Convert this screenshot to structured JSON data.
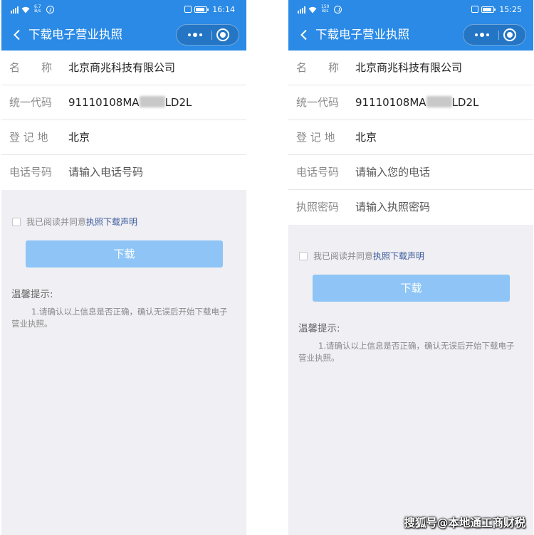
{
  "left": {
    "status_bar": {
      "speed_top": "6.7",
      "speed_unit": "B/s",
      "time": "16:14"
    },
    "nav": {
      "title": "下载电子营业执照"
    },
    "form": {
      "name_label": "名　　称",
      "name_value": "北京商兆科技有限公司",
      "code_label": "统一代码",
      "code_prefix": "91110108MA",
      "code_suffix": "LD2L",
      "region_label": "登 记 地",
      "region_value": "北京",
      "phone_label": "电话号码",
      "phone_placeholder": "请输入电话号码"
    },
    "agree": {
      "text": "我已阅读并同意",
      "link": "执照下载声明"
    },
    "download_label": "下载",
    "tips": {
      "title": "温馨提示:",
      "body": "1.请确认以上信息是否正确，确认无误后开始下载电子营业执照。"
    }
  },
  "right": {
    "status_bar": {
      "speed_top": "150",
      "speed_unit": "B/s",
      "time": "15:25"
    },
    "nav": {
      "title": "下载电子营业执照"
    },
    "form": {
      "name_label": "名　　称",
      "name_value": "北京商兆科技有限公司",
      "code_label": "统一代码",
      "code_prefix": "91110108MA",
      "code_suffix": "LD2L",
      "region_label": "登 记 地",
      "region_value": "北京",
      "phone_label": "电话号码",
      "phone_placeholder": "请输入您的电话",
      "password_label": "执照密码",
      "password_placeholder": "请输入执照密码"
    },
    "agree": {
      "text": "我已阅读并同意",
      "link": "执照下载声明"
    },
    "download_label": "下载",
    "tips": {
      "title": "温馨提示:",
      "body": "1.请确认以上信息是否正确，确认无误后开始下载电子营业执照。"
    }
  },
  "watermark": "搜狐号@本地通工商财税",
  "colors": {
    "nav_blue": "#2a8ae6",
    "button_disabled": "#8ec5f6",
    "link": "#3b5998",
    "page_bg": "#efeff4"
  },
  "icons": [
    "back-arrow-icon",
    "more-dots-icon",
    "close-target-icon",
    "signal-icon",
    "wifi-icon",
    "alarm-icon",
    "vibrate-icon",
    "battery-icon"
  ]
}
